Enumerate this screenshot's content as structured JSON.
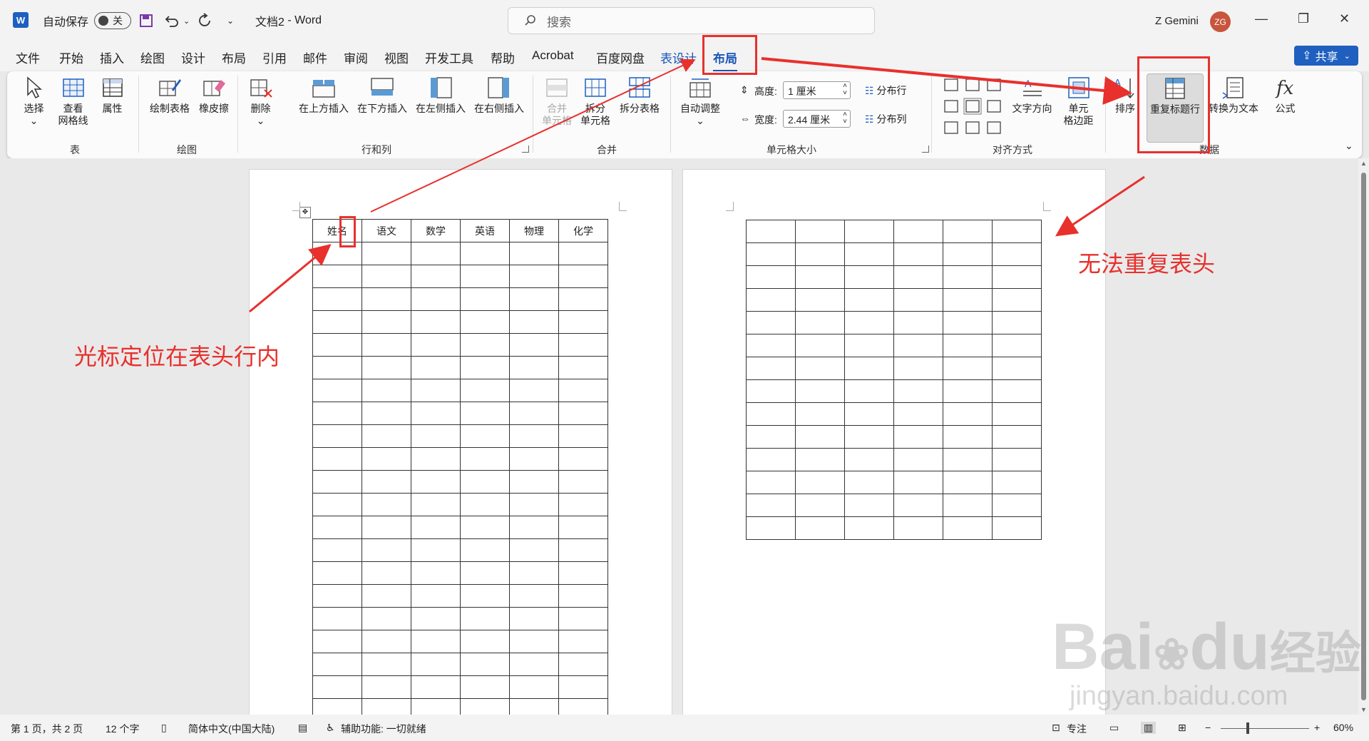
{
  "titlebar": {
    "logo": "W",
    "autosave_label": "自动保存",
    "autosave_state": "关",
    "doc_title": "文档2",
    "app_separator": "-",
    "app_name": "Word",
    "search_placeholder": "搜索",
    "user_name": "Z Gemini",
    "user_initials": "ZG",
    "minimize": "—",
    "restore": "❐",
    "close": "✕"
  },
  "menu": {
    "items": [
      "文件",
      "开始",
      "插入",
      "绘图",
      "设计",
      "布局",
      "引用",
      "邮件",
      "审阅",
      "视图",
      "开发工具",
      "帮助",
      "Acrobat",
      "百度网盘",
      "表设计",
      "布局"
    ],
    "share_label": "共享"
  },
  "ribbon": {
    "table_group": {
      "label": "表",
      "select": "选择",
      "gridlines_1": "查看",
      "gridlines_2": "网格线",
      "properties": "属性"
    },
    "draw_group": {
      "label": "绘图",
      "draw_table": "绘制表格",
      "eraser": "橡皮擦"
    },
    "rowscols_group": {
      "label": "行和列",
      "delete": "删除",
      "insert_above": "在上方插入",
      "insert_below": "在下方插入",
      "insert_left": "在左侧插入",
      "insert_right": "在右侧插入"
    },
    "merge_group": {
      "label": "合并",
      "merge_1": "合并",
      "merge_2": "单元格",
      "split_1": "拆分",
      "split_2": "单元格",
      "split_table": "拆分表格"
    },
    "cellsize_group": {
      "label": "单元格大小",
      "autofit": "自动调整",
      "height_label": "高度:",
      "height_value": "1 厘米",
      "width_label": "宽度:",
      "width_value": "2.44 厘米",
      "distribute_rows": "分布行",
      "distribute_cols": "分布列"
    },
    "align_group": {
      "label": "对齐方式",
      "text_direction": "文字方向",
      "margins_1": "单元",
      "margins_2": "格边距"
    },
    "data_group": {
      "label": "数据",
      "sort": "排序",
      "repeat_header": "重复标题行",
      "convert": "转换为文本",
      "formula": "公式"
    }
  },
  "document": {
    "headers": [
      "姓名",
      "语文",
      "数学",
      "英语",
      "物理",
      "化学"
    ],
    "page1_rows": 22,
    "page2_rows": 14,
    "cols": 6
  },
  "annotations": {
    "cursor_note": "光标定位在表头行内",
    "no_repeat_note": "无法重复表头"
  },
  "status": {
    "page": "第 1 页，共 2 页",
    "words": "12 个字",
    "language": "简体中文(中国大陆)",
    "accessibility": "辅助功能: 一切就绪",
    "focus": "专注",
    "zoom": "60%"
  },
  "watermark": {
    "brand": "Bai",
    "brand2": "du",
    "cn": "经验",
    "url": "jingyan.baidu.com"
  },
  "colors": {
    "accent": "#1a56b8",
    "annotation": "#e8302c",
    "share": "#1f5fbf"
  }
}
